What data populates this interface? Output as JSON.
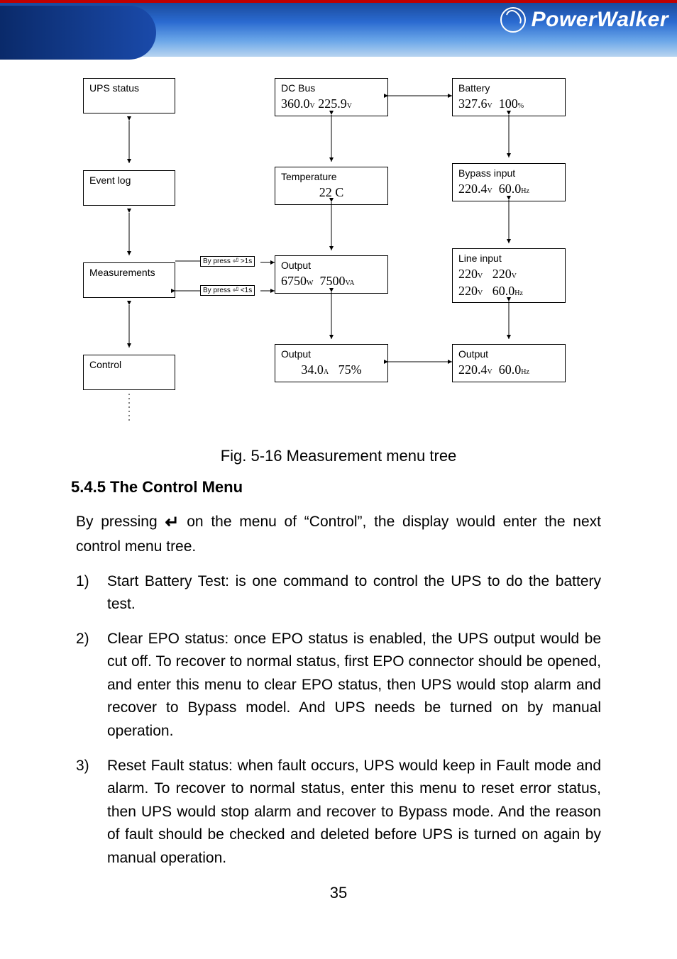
{
  "logo_text": "PowerWalker",
  "diagram": {
    "ups_status": {
      "label": "UPS status"
    },
    "event_log": {
      "label": "Event log"
    },
    "measurements": {
      "label": "Measurements"
    },
    "control": {
      "label": "Control"
    },
    "dc_bus": {
      "label": "DC Bus",
      "v1": "360.0",
      "u1": "V",
      "v2": "225.9",
      "u2": "V"
    },
    "temperature": {
      "label": "Temperature",
      "v1": "22",
      "u1": "C"
    },
    "output_wva": {
      "label": "Output",
      "v1": "6750",
      "u1": "W",
      "v2": "7500",
      "u2": "VA"
    },
    "output_a": {
      "label": "Output",
      "v1": "34.0",
      "u1": "A",
      "v2": "75%"
    },
    "battery": {
      "label": "Battery",
      "v1": "327.6",
      "u1": "V",
      "v2": "100",
      "u2": "%"
    },
    "bypass": {
      "label": "Bypass input",
      "v1": "220.4",
      "u1": "V",
      "v2": "60.0",
      "u2": "Hz"
    },
    "line": {
      "label": "Line input",
      "v1a": "220",
      "v1b": "220",
      "v2a": "220",
      "v2b": "60.0",
      "u": "V",
      "uhz": "Hz"
    },
    "output_vhz": {
      "label": "Output",
      "v1": "220.4",
      "u1": "V",
      "v2": "60.0",
      "u2": "Hz"
    },
    "press_gt": "By press ⏎ >1s",
    "press_lt": "By press ⏎ <1s"
  },
  "fig_caption": "Fig. 5-16 Measurement menu tree",
  "section_heading": "5.4.5 The Control Menu",
  "intro_a": "By pressing ",
  "intro_b": " on the menu of “Control”, the display would enter the next control menu tree.",
  "items": [
    {
      "num": "1)",
      "text": "Start Battery Test: is one command to control the UPS to do the battery test."
    },
    {
      "num": "2)",
      "text": "Clear EPO status: once EPO status is enabled, the UPS output would be cut off. To recover to normal status, first EPO connector should be opened, and enter this menu to clear EPO status, then UPS would stop alarm and recover to Bypass model. And UPS needs be turned on by manual operation."
    },
    {
      "num": "3)",
      "text": "Reset Fault status: when fault occurs, UPS would keep in Fault mode and alarm. To recover to normal status, enter this menu to reset error status, then UPS would stop alarm and recover to Bypass mode. And the reason of fault should be checked and deleted before UPS is turned on again by manual operation."
    }
  ],
  "page_number": "35"
}
